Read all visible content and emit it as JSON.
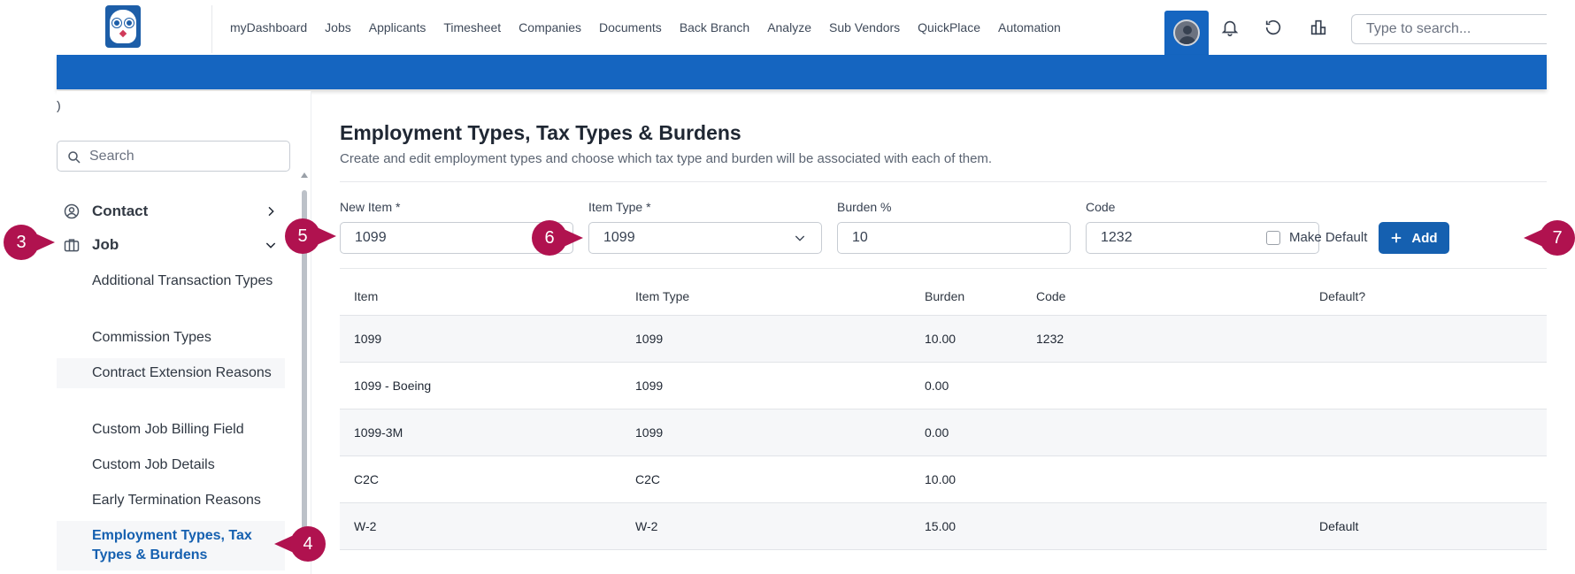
{
  "nav": {
    "links": [
      "myDashboard",
      "Jobs",
      "Applicants",
      "Timesheet",
      "Companies",
      "Documents",
      "Back Branch",
      "Analyze",
      "Sub Vendors",
      "QuickPlace",
      "Automation"
    ],
    "search_placeholder": "Type to search..."
  },
  "sidebar": {
    "collapse_glyph": ")",
    "search_placeholder": "Search",
    "categories": [
      {
        "label": "Contact",
        "icon": "user-circle-icon",
        "expanded": false
      },
      {
        "label": "Job",
        "icon": "briefcase-icon",
        "expanded": true
      }
    ],
    "items": [
      "Additional Transaction Types",
      "Commission Types",
      "Contract Extension Reasons",
      "Custom Job Billing Field",
      "Custom Job Details",
      "Early Termination Reasons",
      "Employment Types, Tax Types & Burdens"
    ],
    "active_item": "Employment Types, Tax Types & Burdens"
  },
  "main": {
    "title": "Employment Types, Tax Types & Burdens",
    "subtitle": "Create and edit employment types and choose which tax type and burden will be associated with each of them.",
    "form": {
      "new_item_label": "New Item *",
      "new_item_value": "1099",
      "item_type_label": "Item Type *",
      "item_type_value": "1099",
      "burden_label": "Burden %",
      "burden_value": "10",
      "code_label": "Code",
      "code_value": "1232",
      "make_default_label": "Make Default",
      "make_default_checked": false,
      "add_label": "Add"
    },
    "table": {
      "headers": [
        "Item",
        "Item Type",
        "Burden",
        "Code",
        "Default?"
      ],
      "rows": [
        [
          "1099",
          "1099",
          "10.00",
          "1232",
          ""
        ],
        [
          "1099 - Boeing",
          "1099",
          "0.00",
          "",
          ""
        ],
        [
          "1099-3M",
          "1099",
          "0.00",
          "",
          ""
        ],
        [
          "C2C",
          "C2C",
          "10.00",
          "",
          ""
        ],
        [
          "W-2",
          "W-2",
          "15.00",
          "",
          "Default"
        ]
      ]
    }
  },
  "callouts": [
    "3",
    "4",
    "5",
    "6",
    "7"
  ],
  "colors": {
    "brand_blue": "#1565c0",
    "accent": "#1560b0",
    "callout": "#b0124f"
  }
}
